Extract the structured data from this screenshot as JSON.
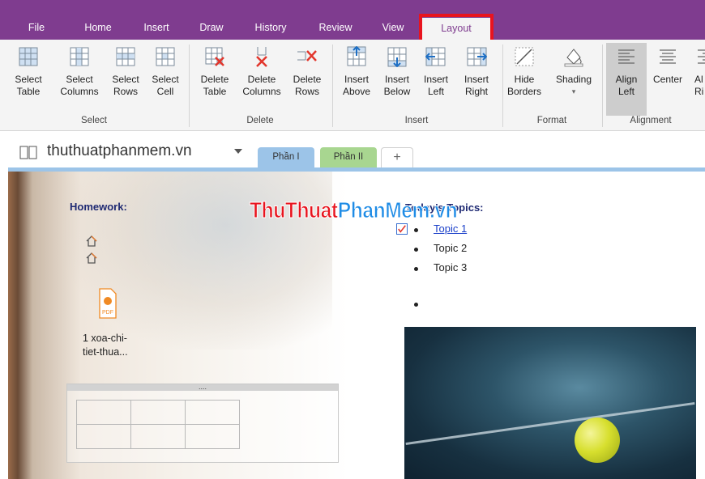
{
  "tabs": [
    "File",
    "Home",
    "Insert",
    "Draw",
    "History",
    "Review",
    "View",
    "Layout"
  ],
  "active_tab": "Layout",
  "ribbon": {
    "groups": [
      {
        "label": "Select",
        "buttons": [
          {
            "l1": "Select",
            "l2": "Table",
            "icon": "select-table-icon"
          },
          {
            "l1": "Select",
            "l2": "Columns",
            "icon": "select-columns-icon"
          },
          {
            "l1": "Select",
            "l2": "Rows",
            "icon": "select-rows-icon"
          },
          {
            "l1": "Select",
            "l2": "Cell",
            "icon": "select-cell-icon"
          }
        ]
      },
      {
        "label": "Delete",
        "buttons": [
          {
            "l1": "Delete",
            "l2": "Table",
            "icon": "delete-table-icon"
          },
          {
            "l1": "Delete",
            "l2": "Columns",
            "icon": "delete-columns-icon"
          },
          {
            "l1": "Delete",
            "l2": "Rows",
            "icon": "delete-rows-icon"
          }
        ]
      },
      {
        "label": "Insert",
        "buttons": [
          {
            "l1": "Insert",
            "l2": "Above",
            "icon": "insert-above-icon"
          },
          {
            "l1": "Insert",
            "l2": "Below",
            "icon": "insert-below-icon"
          },
          {
            "l1": "Insert",
            "l2": "Left",
            "icon": "insert-left-icon"
          },
          {
            "l1": "Insert",
            "l2": "Right",
            "icon": "insert-right-icon"
          }
        ]
      },
      {
        "label": "Format",
        "buttons": [
          {
            "l1": "Hide",
            "l2": "Borders",
            "icon": "hide-borders-icon"
          },
          {
            "l1": "Shading",
            "l2": "▾",
            "icon": "shading-icon"
          }
        ]
      },
      {
        "label": "Alignment",
        "buttons": [
          {
            "l1": "Align",
            "l2": "Left",
            "icon": "align-left-icon"
          },
          {
            "l1": "Center",
            "l2": "",
            "icon": "align-center-icon"
          },
          {
            "l1": "Al",
            "l2": "Ri",
            "icon": "align-right-icon"
          }
        ]
      }
    ]
  },
  "notebook": {
    "title": "thuthuatphanmem.vn",
    "sections": [
      "Phần I",
      "Phần II",
      "+"
    ]
  },
  "page": {
    "homework_title": "Homework:",
    "attachment_name_line1": "1 xoa-chi-",
    "attachment_name_line2": "tiet-thua...",
    "attachment_icon_label": "PDF",
    "table_handle": "....",
    "topics_title": "Today's Topics:",
    "topics": [
      "Topic 1",
      "Topic 2",
      "Topic 3"
    ],
    "watermark_part1": "ThuThuat",
    "watermark_part2": "PhanMem.vn"
  },
  "colors": {
    "onenote_purple": "#7f3c8f",
    "highlight_red": "#e8141e",
    "heading_navy": "#1f2a73",
    "link_blue": "#1a3fc9"
  }
}
